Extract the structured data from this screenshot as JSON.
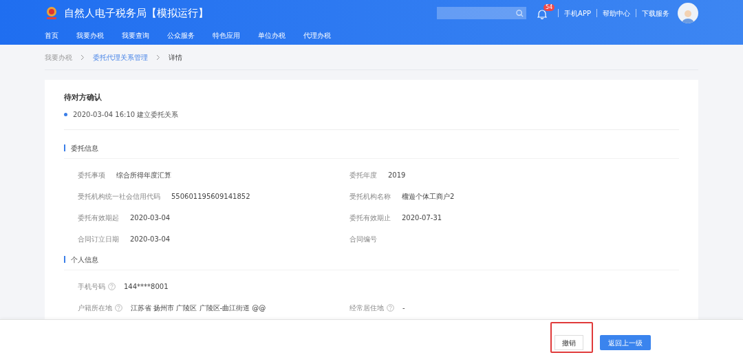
{
  "header": {
    "title": "自然人电子税务局【模拟运行】",
    "notification_count": "54",
    "links": [
      "手机APP",
      "帮助中心",
      "下载服务"
    ]
  },
  "nav": [
    {
      "label": "首页"
    },
    {
      "label": "我要办税"
    },
    {
      "label": "我要查询"
    },
    {
      "label": "公众服务"
    },
    {
      "label": "特色应用"
    },
    {
      "label": "单位办税"
    },
    {
      "label": "代理办税"
    }
  ],
  "breadcrumb": [
    {
      "label": "我要办税",
      "kind": "link"
    },
    {
      "label": "委托代理关系管理",
      "kind": "link"
    },
    {
      "label": "详情",
      "kind": "current"
    }
  ],
  "status": {
    "title": "待对方确认",
    "event": "2020-03-04 16:10 建立委托关系"
  },
  "sections": [
    {
      "title": "委托信息",
      "rows": [
        [
          {
            "label": "委托事项",
            "value": "综合所得年度汇算"
          },
          {
            "label": "委托年度",
            "value": "2019"
          }
        ],
        [
          {
            "label": "受托机构统一社会信用代码",
            "value": "550601195609141852"
          },
          {
            "label": "受托机构名称",
            "value": "榴遊个体工商户2"
          }
        ],
        [
          {
            "label": "委托有效期起",
            "value": "2020-03-04"
          },
          {
            "label": "委托有效期止",
            "value": "2020-07-31"
          }
        ],
        [
          {
            "label": "合同订立日期",
            "value": "2020-03-04"
          },
          {
            "label": "合同编号"
          }
        ]
      ]
    },
    {
      "title": "个人信息",
      "rows": [
        [
          {
            "label": "手机号码",
            "value": "144****8001",
            "help": true
          }
        ],
        [
          {
            "label": "户籍所在地",
            "value": "江苏省 扬州市 广陵区 广陵区-曲江街道 @@",
            "help": true
          },
          {
            "label": "经常居住地",
            "value": "-",
            "help": true
          }
        ]
      ]
    }
  ],
  "footer": {
    "buttons": [
      {
        "label": "撤销",
        "kind": "secondary",
        "highlighted": true
      },
      {
        "label": "返回上一级",
        "kind": "primary",
        "highlighted": false
      }
    ]
  }
}
